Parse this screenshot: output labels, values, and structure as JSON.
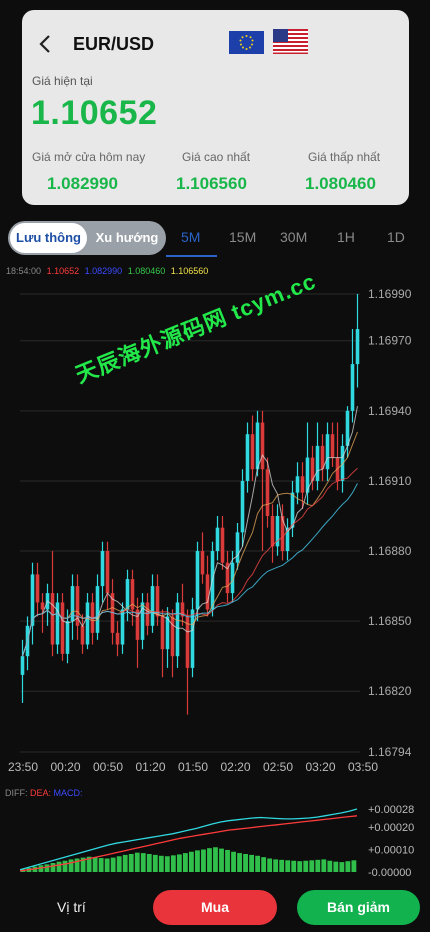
{
  "header": {
    "pair": "EUR/USD",
    "current_label": "Giá hiện tại",
    "current_price": "1.10652",
    "stats": [
      {
        "label": "Giá mở cửa hôm nay",
        "value": "1.082990"
      },
      {
        "label": "Giá cao nhất",
        "value": "1.106560"
      },
      {
        "label": "Giá thấp nhất",
        "value": "1.080460"
      }
    ]
  },
  "tabs": {
    "segment": [
      "Lưu thông",
      "Xu hướng"
    ],
    "timeframes": [
      "5M",
      "15M",
      "30M",
      "1H",
      "1D"
    ],
    "active_timeframe": "5M"
  },
  "info_line": {
    "time": "18:54:00",
    "values": [
      "1.10652",
      "1.082990",
      "1.080460",
      "1.106560"
    ],
    "colors": [
      "#ff3b3b",
      "#3b4bff",
      "#35c94a",
      "#f2e24a"
    ]
  },
  "watermark": "天辰海外源码网 tcym.cc",
  "chart_data": {
    "type": "candlestick",
    "y_ticks": [
      "1.16990",
      "1.16970",
      "1.16940",
      "1.16910",
      "1.16880",
      "1.16850",
      "1.16820",
      "1.16794"
    ],
    "x_ticks": [
      "23:50",
      "00:20",
      "00:50",
      "01:20",
      "01:50",
      "02:20",
      "02:50",
      "03:20",
      "03:50"
    ],
    "ylim": [
      1.16794,
      1.1699
    ],
    "colors": {
      "up": "#30d8e0",
      "down": "#d93a3a"
    },
    "candles": [
      [
        1.16827,
        1.16835,
        1.16815,
        1.16842
      ],
      [
        1.16835,
        1.16848,
        1.16829,
        1.16852
      ],
      [
        1.16848,
        1.1687,
        1.1684,
        1.16875
      ],
      [
        1.1687,
        1.16858,
        1.16852,
        1.16875
      ],
      [
        1.16858,
        1.16855,
        1.16845,
        1.16862
      ],
      [
        1.16855,
        1.16862,
        1.16848,
        1.16866
      ],
      [
        1.16862,
        1.1684,
        1.16835,
        1.1688
      ],
      [
        1.1684,
        1.16858,
        1.16836,
        1.16862
      ],
      [
        1.16858,
        1.16836,
        1.16833,
        1.16862
      ],
      [
        1.16836,
        1.1685,
        1.16832,
        1.16855
      ],
      [
        1.1685,
        1.16865,
        1.16842,
        1.1687
      ],
      [
        1.16865,
        1.16848,
        1.16842,
        1.1687
      ],
      [
        1.16848,
        1.1684,
        1.16836,
        1.16853
      ],
      [
        1.1684,
        1.16858,
        1.16838,
        1.16862
      ],
      [
        1.16858,
        1.16845,
        1.1684,
        1.16862
      ],
      [
        1.16845,
        1.16865,
        1.16842,
        1.1687
      ],
      [
        1.16865,
        1.1688,
        1.16858,
        1.16884
      ],
      [
        1.1688,
        1.16862,
        1.16855,
        1.16884
      ],
      [
        1.16862,
        1.16845,
        1.1684,
        1.16868
      ],
      [
        1.16845,
        1.1684,
        1.16835,
        1.1685
      ],
      [
        1.1684,
        1.16855,
        1.16836,
        1.16858
      ],
      [
        1.16855,
        1.16868,
        1.1685,
        1.16872
      ],
      [
        1.16868,
        1.16855,
        1.16848,
        1.16872
      ],
      [
        1.16855,
        1.16842,
        1.1683,
        1.1686
      ],
      [
        1.16842,
        1.16858,
        1.16838,
        1.16862
      ],
      [
        1.16858,
        1.16848,
        1.16844,
        1.16862
      ],
      [
        1.16848,
        1.16865,
        1.16845,
        1.1687
      ],
      [
        1.16865,
        1.16852,
        1.16848,
        1.1687
      ],
      [
        1.16852,
        1.16838,
        1.16826,
        1.16855
      ],
      [
        1.16838,
        1.16852,
        1.1683,
        1.16856
      ],
      [
        1.16852,
        1.16835,
        1.16826,
        1.16855
      ],
      [
        1.16835,
        1.16858,
        1.1683,
        1.16862
      ],
      [
        1.16858,
        1.16852,
        1.16848,
        1.16866
      ],
      [
        1.16852,
        1.1683,
        1.1681,
        1.16855
      ],
      [
        1.1683,
        1.16855,
        1.16826,
        1.1686
      ],
      [
        1.16855,
        1.1688,
        1.1685,
        1.16884
      ],
      [
        1.1688,
        1.1687,
        1.16866,
        1.16888
      ],
      [
        1.1687,
        1.16855,
        1.16852,
        1.16878
      ],
      [
        1.16855,
        1.1688,
        1.16852,
        1.16884
      ],
      [
        1.1688,
        1.1689,
        1.16876,
        1.16895
      ],
      [
        1.1689,
        1.16875,
        1.16872,
        1.16895
      ],
      [
        1.16875,
        1.16862,
        1.16858,
        1.1688
      ],
      [
        1.16862,
        1.16875,
        1.16858,
        1.1688
      ],
      [
        1.16875,
        1.16888,
        1.16872,
        1.16892
      ],
      [
        1.16888,
        1.1691,
        1.16882,
        1.16915
      ],
      [
        1.1691,
        1.1693,
        1.16905,
        1.16935
      ],
      [
        1.1693,
        1.16915,
        1.1691,
        1.16938
      ],
      [
        1.16915,
        1.16935,
        1.16912,
        1.1694
      ],
      [
        1.16935,
        1.16915,
        1.1688,
        1.1694
      ],
      [
        1.16915,
        1.16895,
        1.1689,
        1.1692
      ],
      [
        1.16895,
        1.16882,
        1.16875,
        1.169
      ],
      [
        1.16882,
        1.16895,
        1.16878,
        1.169
      ],
      [
        1.16895,
        1.1688,
        1.16876,
        1.169
      ],
      [
        1.1688,
        1.1689,
        1.16876,
        1.16894
      ],
      [
        1.1689,
        1.16905,
        1.16886,
        1.1691
      ],
      [
        1.16905,
        1.16912,
        1.169,
        1.16918
      ],
      [
        1.16912,
        1.16905,
        1.16898,
        1.16918
      ],
      [
        1.16905,
        1.1692,
        1.169,
        1.16935
      ],
      [
        1.1692,
        1.1691,
        1.16906,
        1.16925
      ],
      [
        1.1691,
        1.16925,
        1.16906,
        1.16935
      ],
      [
        1.16925,
        1.16915,
        1.1691,
        1.1693
      ],
      [
        1.16915,
        1.1693,
        1.1691,
        1.16935
      ],
      [
        1.1693,
        1.1692,
        1.16916,
        1.16935
      ],
      [
        1.1692,
        1.1691,
        1.16906,
        1.16935
      ],
      [
        1.1691,
        1.16925,
        1.16905,
        1.1693
      ],
      [
        1.16925,
        1.1694,
        1.1692,
        1.16942
      ],
      [
        1.1694,
        1.1696,
        1.16935,
        1.16975
      ],
      [
        1.1696,
        1.16975,
        1.1695,
        1.1699
      ]
    ],
    "ma_lines": [
      {
        "color": "#d9d9d9"
      },
      {
        "color": "#e8a85a"
      },
      {
        "color": "#ff4a4a"
      },
      {
        "color": "#4ad8ff"
      }
    ],
    "macd": {
      "label_diff": "DIFF:",
      "label_dea": "DEA:",
      "label_macd": "MACD:",
      "y_ticks": [
        "+0.00028",
        "+0.00020",
        "+0.00010",
        "-0.00000"
      ],
      "ylim": [
        0,
        0.00032
      ],
      "histogram": [
        1.2e-05,
        1.8e-05,
        2.4e-05,
        3e-05,
        3.4e-05,
        4e-05,
        4.6e-05,
        5e-05,
        5.6e-05,
        6e-05,
        6.4e-05,
        6.8e-05,
        6.6e-05,
        6.2e-05,
        6e-05,
        6.4e-05,
        7e-05,
        7.6e-05,
        8e-05,
        8.6e-05,
        8.4e-05,
        8e-05,
        7.6e-05,
        7.2e-05,
        7e-05,
        7.4e-05,
        7.8e-05,
        8.4e-05,
        9e-05,
        9.6e-05,
        0.0001,
        0.000106,
        0.00011,
        0.000104,
        9.8e-05,
        9e-05,
        8.4e-05,
        8e-05,
        7.6e-05,
        7.2e-05,
        6.6e-05,
        6e-05,
        5.6e-05,
        5.4e-05,
        5.2e-05,
        5e-05,
        4.8e-05,
        5e-05,
        5.2e-05,
        5.4e-05,
        5.6e-05,
        5e-05,
        4.6e-05,
        4.4e-05,
        4.8e-05,
        5.2e-05
      ],
      "diff": [
        1e-05,
        2e-05,
        3e-05,
        4e-05,
        5e-05,
        6e-05,
        7e-05,
        8e-05,
        9e-05,
        0.0001,
        0.00011,
        0.00012,
        0.000128,
        0.000134,
        0.00014,
        0.000146,
        0.000152,
        0.000158,
        0.000164,
        0.00017,
        0.000178,
        0.000186,
        0.000194,
        0.000204,
        0.000214,
        0.000222,
        0.000228,
        0.000232,
        0.000236,
        0.00024,
        0.000242,
        0.00024,
        0.000238,
        0.000236,
        0.000236,
        0.000238,
        0.00024,
        0.000244,
        0.00025,
        0.000256,
        0.000262,
        0.00027,
        0.00028
      ],
      "dea": [
        5e-06,
        1e-05,
        1.5e-05,
        2e-05,
        2.6e-05,
        3.2e-05,
        3.8e-05,
        4.6e-05,
        5.4e-05,
        6.2e-05,
        7e-05,
        7.8e-05,
        8.6e-05,
        9.4e-05,
        0.000102,
        0.00011,
        0.000118,
        0.000126,
        0.000134,
        0.000142,
        0.00015,
        0.000156,
        0.000162,
        0.000168,
        0.000174,
        0.00018,
        0.000186,
        0.00019,
        0.000194,
        0.000198,
        0.000202,
        0.000206,
        0.00021,
        0.000214,
        0.000218,
        0.000222,
        0.000226,
        0.00023,
        0.000234,
        0.000238,
        0.000242,
        0.000246,
        0.00025
      ]
    }
  },
  "bottom": {
    "position_label": "Vị trí",
    "buy_label": "Mua",
    "sell_label": "Bán giảm"
  }
}
